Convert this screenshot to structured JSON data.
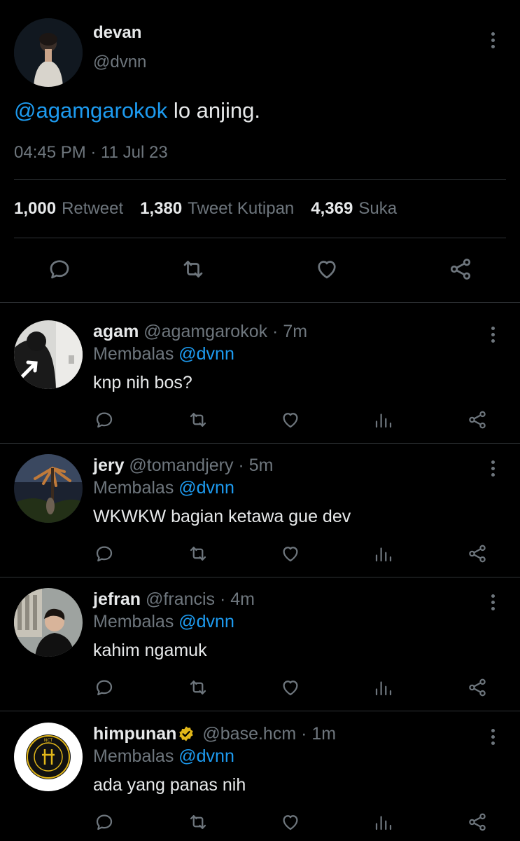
{
  "main_tweet": {
    "name": "devan",
    "handle": "@dvnn",
    "mention": "@agamgarokok",
    "text": " lo anjing.",
    "timestamp": "04:45 PM · 11 Jul 23",
    "stats": {
      "retweets_count": "1,000",
      "retweets_label": "Retweet",
      "quotes_count": "1,380",
      "quotes_label": "Tweet Kutipan",
      "likes_count": "4,369",
      "likes_label": "Suka"
    },
    "icons": [
      "reply-icon",
      "retweet-icon",
      "like-icon",
      "share-icon"
    ]
  },
  "replies": [
    {
      "name": "agam",
      "meta": " @agamgarokok · 7m",
      "replying_prefix": "Membalas ",
      "replying_to": "@dvnn",
      "text": "knp nih bos?",
      "verified": false
    },
    {
      "name": "jery",
      "meta": " @tomandjery · 5m",
      "replying_prefix": "Membalas ",
      "replying_to": "@dvnn",
      "text": "WKWKW bagian ketawa gue dev",
      "verified": false
    },
    {
      "name": "jefran",
      "meta": " @francis · 4m",
      "replying_prefix": "Membalas ",
      "replying_to": "@dvnn",
      "text": "kahim ngamuk",
      "verified": false
    },
    {
      "name": "himpunan",
      "meta": " @base.hcm · 1m",
      "replying_prefix": "Membalas ",
      "replying_to": "@dvnn",
      "text": "ada yang panas nih",
      "verified": true
    }
  ],
  "colors": {
    "background": "#000000",
    "text": "#e7e9ea",
    "muted": "#6e767d",
    "accent": "#1d9bf0",
    "verified_gold": "#e2b719",
    "divider": "#2f3336"
  }
}
